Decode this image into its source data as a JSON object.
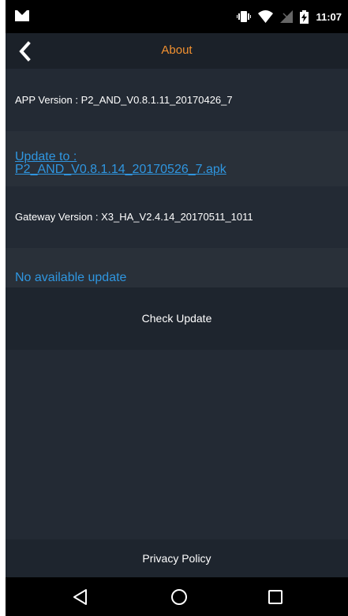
{
  "status_bar": {
    "time": "11:07",
    "icons": [
      "mail-icon",
      "vibrate-icon",
      "wifi-icon",
      "no-signal-icon",
      "battery-charging-icon"
    ]
  },
  "header": {
    "title": "About",
    "back_icon": "chevron-left-icon"
  },
  "about": {
    "app_version_text": "APP Version : P2_AND_V0.8.1.11_20170426_7",
    "update_link_line1": "Update to :",
    "update_link_line2": "P2_AND_V0.8.1.14_20170526_7.apk",
    "gateway_version_text": "Gateway Version : X3_HA_V2.4.14_20170511_1011",
    "gateway_update_status": "No available update",
    "check_update_label": "Check Update",
    "privacy_policy_label": "Privacy Policy"
  },
  "nav_bar": {
    "icons": [
      "back-triangle-icon",
      "home-circle-icon",
      "recents-square-icon"
    ]
  },
  "colors": {
    "accent_title": "#f29130",
    "link_blue": "#2f96e0",
    "background": "#232a34"
  }
}
